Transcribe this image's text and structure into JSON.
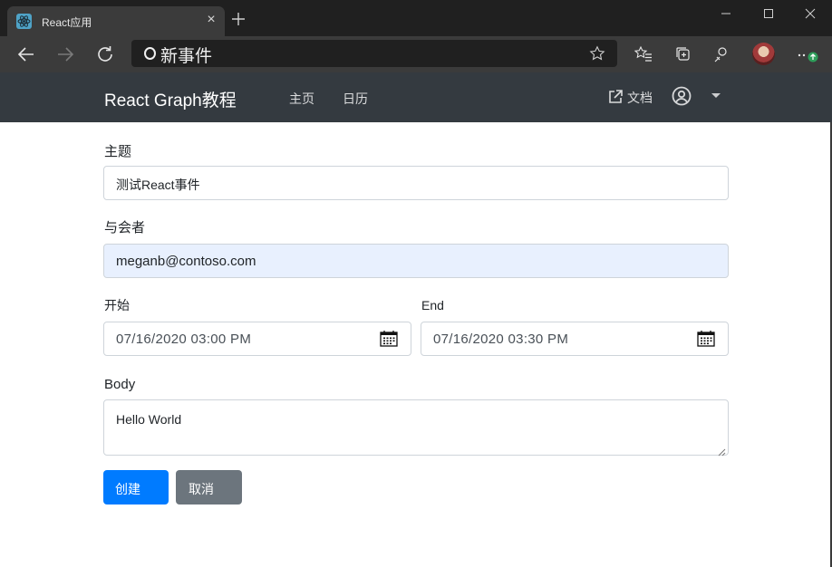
{
  "browser": {
    "tab_title": "React应用",
    "tab_close": "×",
    "address": "新事件"
  },
  "navbar": {
    "brand": "React Graph教程",
    "links": [
      "主页",
      "日历"
    ],
    "docs": "文档"
  },
  "form": {
    "subject_label": "主题",
    "subject_value": "测试React事件",
    "attendees_label": "与会者",
    "attendees_value": "meganb@contoso.com",
    "start_label": "开始",
    "start_value": "07/16/2020 03:00 PM",
    "end_label": "End",
    "end_value": "07/16/2020 03:30 PM",
    "body_label": "Body",
    "body_value": "Hello World",
    "create_label": "创建",
    "cancel_label": "取消"
  },
  "colors": {
    "chrome_dark": "#202020",
    "chrome_toolbar": "#3b3b3b",
    "navbar": "#343a40",
    "primary": "#007bff",
    "secondary": "#6c757d",
    "autofill": "#e8f0fe"
  }
}
